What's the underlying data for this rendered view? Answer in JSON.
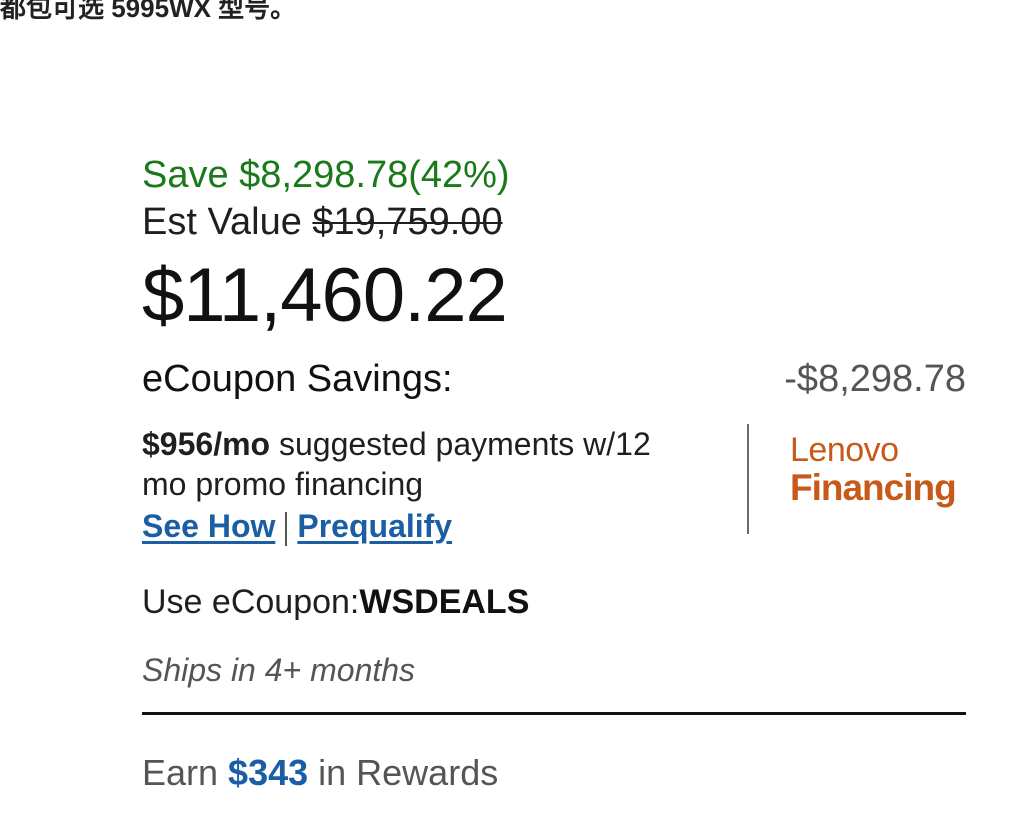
{
  "top_fragment": "都包可选 5995WX 型号。",
  "pricing": {
    "save_text": "Save $8,298.78(42%)",
    "est_label": "Est Value ",
    "est_value": "$19,759.00",
    "price": "$11,460.22",
    "ecoupon_label": "eCoupon Savings:",
    "ecoupon_amount": "-$8,298.78"
  },
  "financing": {
    "monthly": "$956/mo",
    "text": " suggested payments w/12 mo promo financing",
    "see_how": "See How",
    "prequalify": "Prequalify",
    "logo_line1": "Lenovo",
    "logo_line2": "Financing"
  },
  "coupon": {
    "label": "Use eCoupon:",
    "code": "WSDEALS"
  },
  "shipping": "Ships in 4+ months",
  "rewards": {
    "prefix": "Earn ",
    "amount": "$343",
    "suffix": " in Rewards"
  },
  "colors": {
    "save_green": "#1a7a1a",
    "link_blue": "#1b5ea3",
    "lenovo_orange": "#c85a19"
  }
}
